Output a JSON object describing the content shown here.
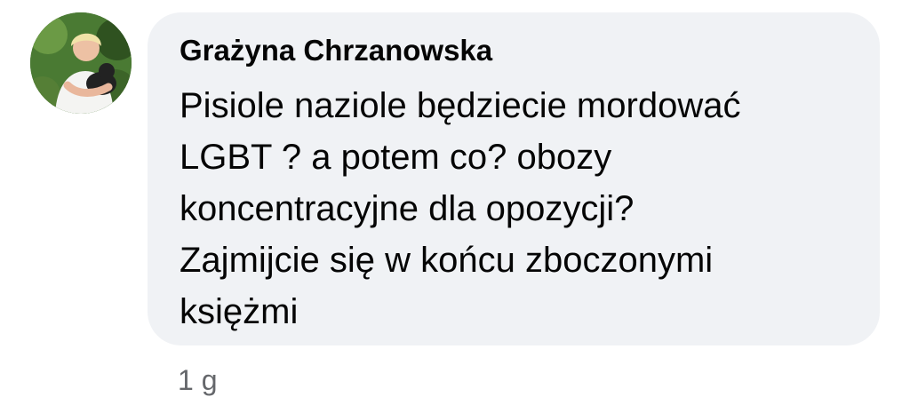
{
  "comment": {
    "author_name": "Grażyna Chrzanowska",
    "avatar_icon": "user-avatar-photo",
    "text_lines": [
      "Pisiole naziole będziecie mordować",
      "LGBT ? a potem co? obozy",
      "koncentracyjne dla opozycji?",
      "Zajmijcie się w końcu zboczonymi",
      "księżmi"
    ],
    "timestamp": "1 g"
  },
  "colors": {
    "bubble_background": "#f0f2f5",
    "text": "#050505",
    "secondary_text": "#65676b"
  }
}
